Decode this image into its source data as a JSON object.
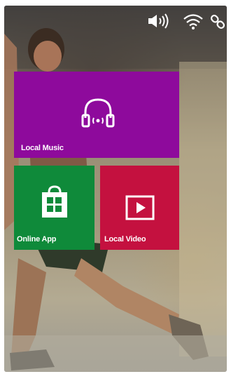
{
  "colors": {
    "music_tile": "#8e0a9c",
    "app_tile": "#0f8a3a",
    "video_tile": "#c4113f"
  },
  "status_bar": {
    "icons": [
      "volume-icon",
      "wifi-icon",
      "link-icon"
    ]
  },
  "tiles": [
    {
      "label": "Local Music",
      "icon": "headphones-icon"
    },
    {
      "label": "Online App",
      "icon": "store-bag-icon"
    },
    {
      "label": "Local Video",
      "icon": "play-icon"
    }
  ]
}
